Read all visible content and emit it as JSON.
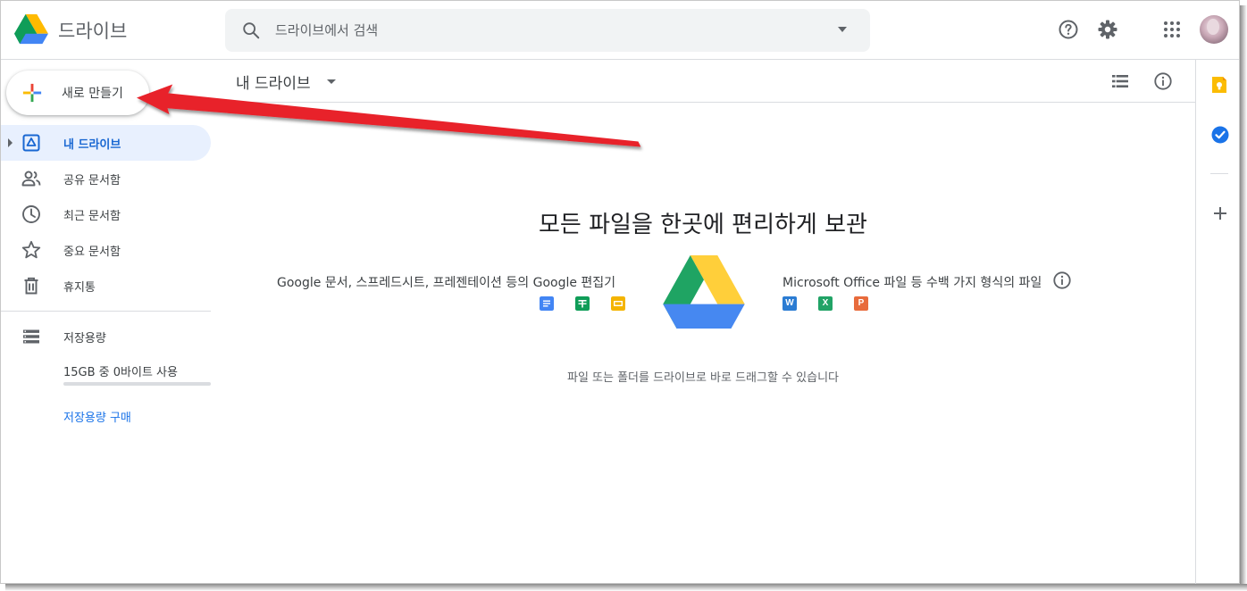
{
  "header": {
    "app_title": "드라이브",
    "search_placeholder": "드라이브에서 검색"
  },
  "icons": {
    "header": [
      "help-icon",
      "settings-icon",
      "apps-grid-icon"
    ],
    "side_panel": [
      "keep-icon",
      "tasks-icon",
      "add-icon"
    ]
  },
  "sidebar": {
    "new_button": "새로 만들기",
    "items": [
      {
        "label": "내 드라이브",
        "icon": "my-drive-icon",
        "active": true
      },
      {
        "label": "공유 문서함",
        "icon": "shared-people-icon"
      },
      {
        "label": "최근 문서함",
        "icon": "clock-icon"
      },
      {
        "label": "중요 문서함",
        "icon": "star-icon"
      },
      {
        "label": "휴지통",
        "icon": "trash-icon"
      }
    ],
    "storage": {
      "title": "저장용량",
      "usage": "15GB 중 0바이트 사용",
      "used_fraction": 0,
      "buy_link": "저장용량 구매"
    }
  },
  "main": {
    "title": "내 드라이브",
    "empty_state": {
      "title": "모든 파일을 한곳에 편리하게 보관",
      "google_text": "Google 문서, 스프레드시트, 프레젠테이션 등의 Google 편집기",
      "ms_text": "Microsoft Office 파일 등 수백 가지 형식의 파일",
      "ms_letters": [
        "W",
        "X",
        "P"
      ],
      "drop_hint": "파일 또는 폴더를 드라이브로 바로 드래그할 수 있습니다"
    }
  },
  "colors": {
    "accent_blue": "#1a73e8",
    "active_bg": "#e8f0fe",
    "annotation_red": "#e8202a",
    "docs_blue": "#4285f4",
    "sheets_green": "#0f9d58",
    "slides_yellow": "#f4b400",
    "word_blue": "#2b7cd3",
    "excel_green": "#21a366",
    "powerpoint_orange": "#e86b3c"
  }
}
